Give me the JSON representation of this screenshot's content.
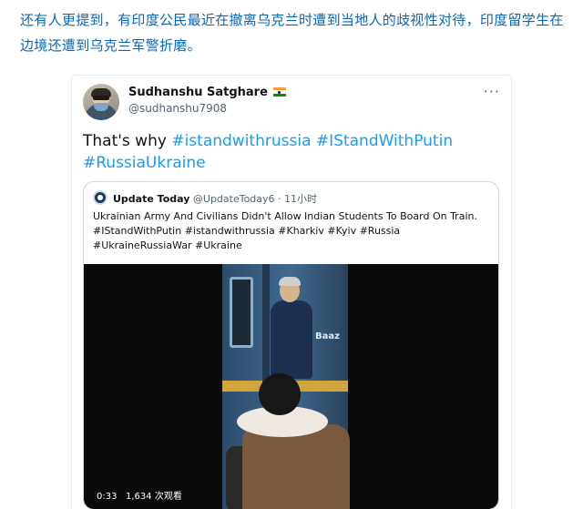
{
  "article": {
    "text": "还有人更提到，有印度公民最近在撤离乌克兰时遭到当地人的歧视性对待，印度留学生在边境还遭到乌克兰军警折磨。"
  },
  "tweet": {
    "display_name": "Sudhanshu Satghare",
    "handle": "@sudhanshu7908",
    "flag_icon": "india-flag-icon",
    "more_icon": "more-horizontal-icon",
    "text_prefix": "That's why ",
    "hashtags": [
      "#istandwithrussia",
      "#IStandWithPutin",
      "#RussiaUkraine"
    ],
    "quote": {
      "name": "Update Today",
      "handle": "@UpdateToday6",
      "separator": "·",
      "time": "11小时",
      "text": "Ukrainian Army And Civilians Didn't Allow Indian Students To Board On Train.",
      "tags_line1": "#IStandWithPutin #istandwithrussia #Kharkiv #Kyiv #Russia",
      "tags_line2": "#UkraineRussiaWar #Ukraine",
      "video": {
        "duration": "0:33",
        "views": "1,634 次观看",
        "watermark": "Baaz"
      }
    }
  },
  "colors": {
    "article_text": "#0b67b2",
    "hashtag": "#1d9bf0",
    "secondary_text": "#536471",
    "border": "#cfd9de"
  }
}
